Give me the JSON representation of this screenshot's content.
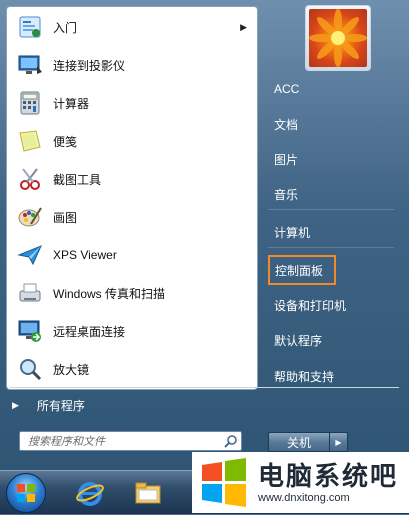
{
  "left_pane": {
    "programs": [
      {
        "label": "入门",
        "icon": "getting-started-icon",
        "has_submenu": true
      },
      {
        "label": "连接到投影仪",
        "icon": "projector-icon"
      },
      {
        "label": "计算器",
        "icon": "calculator-icon"
      },
      {
        "label": "便笺",
        "icon": "sticky-notes-icon"
      },
      {
        "label": "截图工具",
        "icon": "snipping-tool-icon"
      },
      {
        "label": "画图",
        "icon": "paint-icon"
      },
      {
        "label": "XPS Viewer",
        "icon": "xps-viewer-icon"
      },
      {
        "label": "Windows 传真和扫描",
        "icon": "fax-scan-icon"
      },
      {
        "label": "远程桌面连接",
        "icon": "remote-desktop-icon"
      },
      {
        "label": "放大镜",
        "icon": "magnifier-icon"
      }
    ],
    "all_programs": "所有程序",
    "search_placeholder": "搜索程序和文件"
  },
  "right_pane": {
    "items": [
      {
        "label": "ACC"
      },
      {
        "label": "文档"
      },
      {
        "label": "图片"
      },
      {
        "label": "音乐"
      },
      {
        "label": "计算机"
      },
      {
        "label": "控制面板",
        "highlighted": true
      },
      {
        "label": "设备和打印机"
      },
      {
        "label": "默认程序"
      },
      {
        "label": "帮助和支持"
      }
    ],
    "shutdown_label": "关机"
  },
  "taskbar": {
    "icons": [
      "start-orb-icon",
      "internet-explorer-icon",
      "file-explorer-icon"
    ]
  },
  "watermark": {
    "title": "电脑系统吧",
    "url": "www.dnxitong.com"
  },
  "colors": {
    "highlight_border": "#f28a2a",
    "menu_bg": "#3f6384"
  }
}
